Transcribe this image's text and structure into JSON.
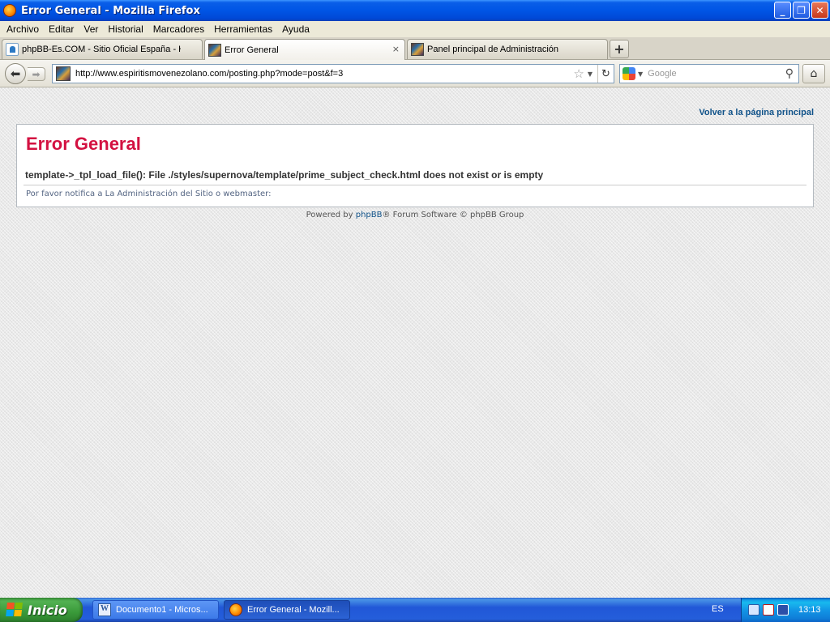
{
  "window": {
    "title": "Error General - Mozilla Firefox"
  },
  "menu": {
    "items": [
      "Archivo",
      "Editar",
      "Ver",
      "Historial",
      "Marcadores",
      "Herramientas",
      "Ayuda"
    ]
  },
  "tabs": [
    {
      "label": "phpBB-Es.COM - Sitio Oficial España - His..."
    },
    {
      "label": "Error General"
    },
    {
      "label": "Panel principal de Administración"
    }
  ],
  "tab_close_glyph": "×",
  "newtab_glyph": "+",
  "nav": {
    "url": "http://www.espiritismovenezolano.com/posting.php?mode=post&f=3",
    "search_placeholder": "Google"
  },
  "page": {
    "back_link": "Volver a la página principal",
    "heading": "Error General",
    "message": "template->_tpl_load_file(): File ./styles/supernova/template/prime_subject_check.html does not exist or is empty",
    "notify": "Por favor notifica a La Administración del Sitio o webmaster:",
    "footer_prefix": "Powered by ",
    "footer_link": "phpBB",
    "footer_suffix": "® Forum Software © phpBB Group"
  },
  "taskbar": {
    "start_label": "Inicio",
    "tasks": [
      {
        "label": "Documento1 - Micros..."
      },
      {
        "label": "Error General - Mozill..."
      }
    ],
    "lang": "ES",
    "clock": "13:13"
  },
  "icons": {
    "app": "firefox-icon",
    "back": "back-arrow-icon",
    "forward": "forward-arrow-icon",
    "star": "bookmark-star-icon",
    "reload": "reload-icon",
    "search": "magnifier-icon",
    "home": "home-icon"
  },
  "colors": {
    "heading": "#d31141",
    "link": "#105289",
    "titlebar": "#0055e5"
  }
}
